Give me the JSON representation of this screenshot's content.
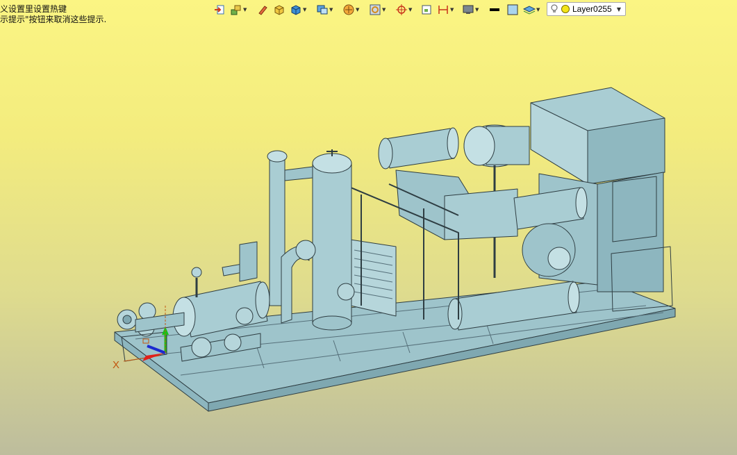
{
  "hints": {
    "line1": "义设置里设置热键",
    "line2": "示提示\"按钮来取消这些提示."
  },
  "toolbar": {
    "layer_name": "Layer0255",
    "dropdown_arrow": "▼",
    "tools": [
      "exit-icon",
      "assembly-icon",
      "pencil-icon",
      "solid-box-icon",
      "block-icon",
      "view-cube-icon",
      "render-mode-icon",
      "snap-icon",
      "target-icon",
      "frame-icon",
      "measure-icon",
      "display-icon",
      "color-black-icon",
      "color-fill-icon",
      "layer-stack-icon"
    ]
  },
  "colors": {
    "model_fill": "#a9cdd3",
    "model_dark": "#7fa8b1",
    "model_line": "#2e3d42",
    "background_top": "#fbf583",
    "background_bottom": "#bdbd9d"
  },
  "axes": {
    "x_label": "X"
  }
}
